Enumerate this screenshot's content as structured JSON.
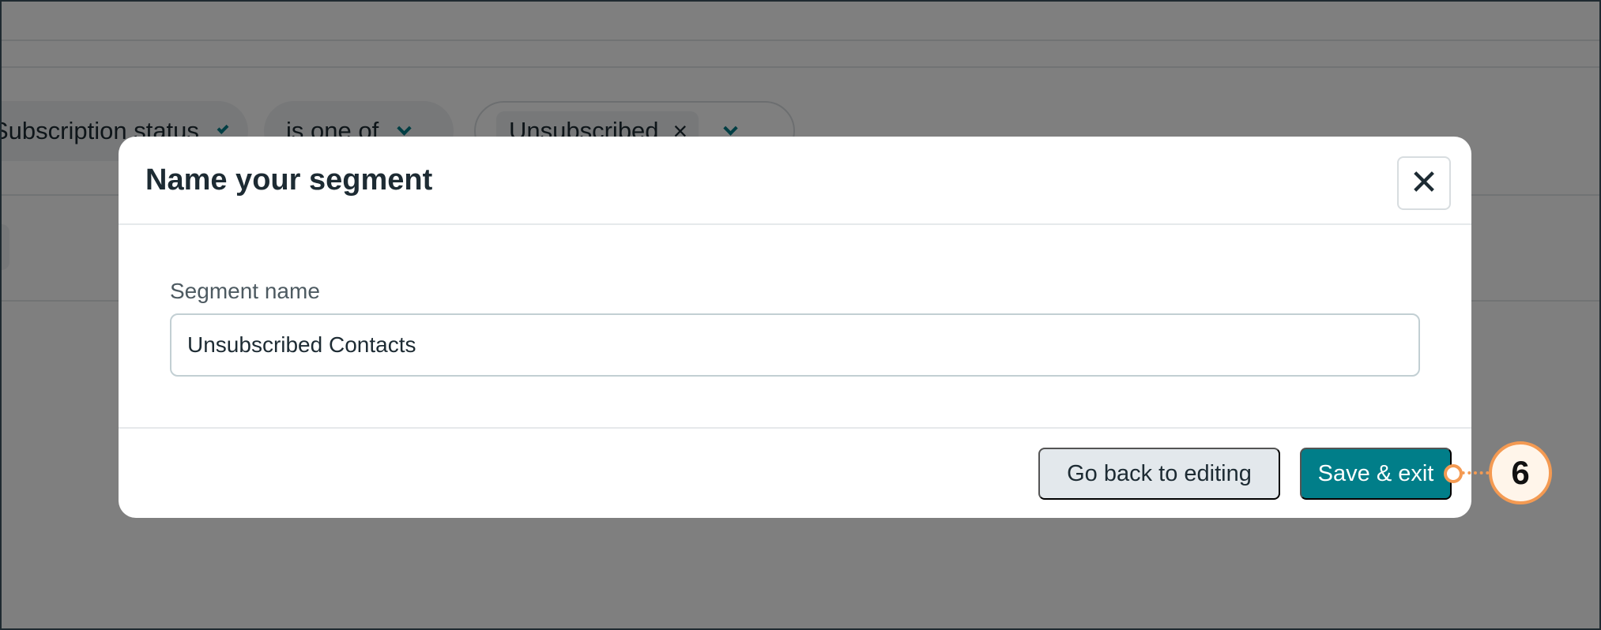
{
  "background": {
    "filter_field": "Subscription status",
    "operator": "is one of",
    "value_tag": "Unsubscribed",
    "remove_tag_glyph": "×"
  },
  "modal": {
    "title": "Name your segment",
    "close_glyph": "✕",
    "field_label": "Segment name",
    "field_value": "Unsubscribed Contacts",
    "secondary_button": "Go back to editing",
    "primary_button": "Save & exit"
  },
  "callout": {
    "step_number": "6",
    "color": "#f49a52"
  },
  "colors": {
    "primary": "#017e89",
    "secondary_bg": "#e3e8ec",
    "text": "#1d2b33",
    "overlay": "rgba(0,0,0,0.5)"
  }
}
